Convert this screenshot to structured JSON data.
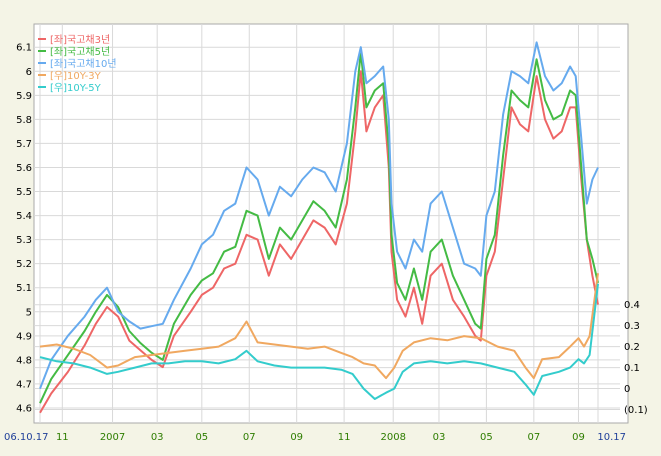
{
  "chart_data": {
    "type": "line",
    "left_axis": {
      "ticks": [
        "4.6",
        "4.7",
        "4.8",
        "4.9",
        "5",
        "5.1",
        "5.2",
        "5.3",
        "5.4",
        "5.5",
        "5.6",
        "5.7",
        "5.8",
        "5.9",
        "6",
        "6.1"
      ],
      "ylim": [
        4.55,
        6.18
      ]
    },
    "right_axis": {
      "ticks": [
        "0.4",
        "0.3",
        "0.2",
        "0.1",
        "0",
        "(0.1)"
      ],
      "ylim": [
        -0.15,
        1.72
      ]
    },
    "x_ticks": [
      {
        "label": "06.10.17",
        "pos": 0.0,
        "color": "#1f3f99"
      },
      {
        "label": "11",
        "pos": 0.04,
        "color": "#2e7d00"
      },
      {
        "label": "2007",
        "pos": 0.13,
        "color": "#2e7d00"
      },
      {
        "label": "03",
        "pos": 0.21,
        "color": "#2e7d00"
      },
      {
        "label": "05",
        "pos": 0.29,
        "color": "#2e7d00"
      },
      {
        "label": "07",
        "pos": 0.375,
        "color": "#2e7d00"
      },
      {
        "label": "09",
        "pos": 0.46,
        "color": "#2e7d00"
      },
      {
        "label": "11",
        "pos": 0.545,
        "color": "#2e7d00"
      },
      {
        "label": "2008",
        "pos": 0.633,
        "color": "#2e7d00"
      },
      {
        "label": "03",
        "pos": 0.715,
        "color": "#2e7d00"
      },
      {
        "label": "05",
        "pos": 0.8,
        "color": "#2e7d00"
      },
      {
        "label": "07",
        "pos": 0.885,
        "color": "#2e7d00"
      },
      {
        "label": "09",
        "pos": 0.965,
        "color": "#2e7d00"
      },
      {
        "label": "10.17",
        "pos": 1.0,
        "color": "#1f3f99"
      }
    ],
    "grid": true,
    "legend_position": "top-left",
    "series": [
      {
        "name": "[좌]국고채3년",
        "axis": "left",
        "color": "#ee6666",
        "points": [
          [
            0,
            4.58
          ],
          [
            0.02,
            4.66
          ],
          [
            0.05,
            4.75
          ],
          [
            0.08,
            4.86
          ],
          [
            0.1,
            4.95
          ],
          [
            0.12,
            5.02
          ],
          [
            0.14,
            4.98
          ],
          [
            0.16,
            4.88
          ],
          [
            0.18,
            4.84
          ],
          [
            0.2,
            4.8
          ],
          [
            0.22,
            4.77
          ],
          [
            0.24,
            4.9
          ],
          [
            0.27,
            5.0
          ],
          [
            0.29,
            5.07
          ],
          [
            0.31,
            5.1
          ],
          [
            0.33,
            5.18
          ],
          [
            0.35,
            5.2
          ],
          [
            0.37,
            5.32
          ],
          [
            0.39,
            5.3
          ],
          [
            0.41,
            5.15
          ],
          [
            0.43,
            5.28
          ],
          [
            0.45,
            5.22
          ],
          [
            0.47,
            5.3
          ],
          [
            0.49,
            5.38
          ],
          [
            0.51,
            5.35
          ],
          [
            0.53,
            5.28
          ],
          [
            0.55,
            5.45
          ],
          [
            0.565,
            5.75
          ],
          [
            0.575,
            6.0
          ],
          [
            0.585,
            5.75
          ],
          [
            0.6,
            5.85
          ],
          [
            0.615,
            5.9
          ],
          [
            0.625,
            5.6
          ],
          [
            0.63,
            5.25
          ],
          [
            0.64,
            5.05
          ],
          [
            0.655,
            4.98
          ],
          [
            0.67,
            5.1
          ],
          [
            0.685,
            4.95
          ],
          [
            0.7,
            5.15
          ],
          [
            0.72,
            5.2
          ],
          [
            0.74,
            5.05
          ],
          [
            0.76,
            4.98
          ],
          [
            0.78,
            4.9
          ],
          [
            0.79,
            4.88
          ],
          [
            0.8,
            5.15
          ],
          [
            0.815,
            5.25
          ],
          [
            0.83,
            5.55
          ],
          [
            0.845,
            5.85
          ],
          [
            0.86,
            5.78
          ],
          [
            0.875,
            5.75
          ],
          [
            0.89,
            5.98
          ],
          [
            0.905,
            5.8
          ],
          [
            0.92,
            5.72
          ],
          [
            0.935,
            5.75
          ],
          [
            0.95,
            5.85
          ],
          [
            0.96,
            5.85
          ],
          [
            0.97,
            5.55
          ],
          [
            0.98,
            5.3
          ],
          [
            0.99,
            5.15
          ],
          [
            1.0,
            5.03
          ]
        ]
      },
      {
        "name": "[좌]국고채5년",
        "axis": "left",
        "color": "#44bb44",
        "points": [
          [
            0,
            4.62
          ],
          [
            0.02,
            4.72
          ],
          [
            0.05,
            4.82
          ],
          [
            0.08,
            4.92
          ],
          [
            0.1,
            5.0
          ],
          [
            0.12,
            5.07
          ],
          [
            0.14,
            5.02
          ],
          [
            0.16,
            4.92
          ],
          [
            0.18,
            4.87
          ],
          [
            0.2,
            4.83
          ],
          [
            0.22,
            4.8
          ],
          [
            0.24,
            4.95
          ],
          [
            0.27,
            5.07
          ],
          [
            0.29,
            5.13
          ],
          [
            0.31,
            5.16
          ],
          [
            0.33,
            5.25
          ],
          [
            0.35,
            5.27
          ],
          [
            0.37,
            5.42
          ],
          [
            0.39,
            5.4
          ],
          [
            0.41,
            5.22
          ],
          [
            0.43,
            5.35
          ],
          [
            0.45,
            5.3
          ],
          [
            0.47,
            5.38
          ],
          [
            0.49,
            5.46
          ],
          [
            0.51,
            5.42
          ],
          [
            0.53,
            5.35
          ],
          [
            0.55,
            5.55
          ],
          [
            0.565,
            5.85
          ],
          [
            0.575,
            6.08
          ],
          [
            0.585,
            5.85
          ],
          [
            0.6,
            5.92
          ],
          [
            0.615,
            5.95
          ],
          [
            0.625,
            5.68
          ],
          [
            0.63,
            5.32
          ],
          [
            0.64,
            5.12
          ],
          [
            0.655,
            5.05
          ],
          [
            0.67,
            5.18
          ],
          [
            0.685,
            5.05
          ],
          [
            0.7,
            5.25
          ],
          [
            0.72,
            5.3
          ],
          [
            0.74,
            5.15
          ],
          [
            0.76,
            5.05
          ],
          [
            0.78,
            4.95
          ],
          [
            0.79,
            4.93
          ],
          [
            0.8,
            5.22
          ],
          [
            0.815,
            5.32
          ],
          [
            0.83,
            5.65
          ],
          [
            0.845,
            5.92
          ],
          [
            0.86,
            5.88
          ],
          [
            0.875,
            5.85
          ],
          [
            0.89,
            6.05
          ],
          [
            0.905,
            5.88
          ],
          [
            0.92,
            5.8
          ],
          [
            0.935,
            5.82
          ],
          [
            0.95,
            5.92
          ],
          [
            0.96,
            5.9
          ],
          [
            0.97,
            5.6
          ],
          [
            0.98,
            5.3
          ],
          [
            0.99,
            5.22
          ],
          [
            1.0,
            5.12
          ]
        ]
      },
      {
        "name": "[좌]국고채10년",
        "axis": "left",
        "color": "#66aaee",
        "points": [
          [
            0,
            4.68
          ],
          [
            0.02,
            4.8
          ],
          [
            0.05,
            4.9
          ],
          [
            0.08,
            4.98
          ],
          [
            0.1,
            5.05
          ],
          [
            0.12,
            5.1
          ],
          [
            0.14,
            5.0
          ],
          [
            0.16,
            4.96
          ],
          [
            0.18,
            4.93
          ],
          [
            0.2,
            4.94
          ],
          [
            0.22,
            4.95
          ],
          [
            0.24,
            5.05
          ],
          [
            0.27,
            5.18
          ],
          [
            0.29,
            5.28
          ],
          [
            0.31,
            5.32
          ],
          [
            0.33,
            5.42
          ],
          [
            0.35,
            5.45
          ],
          [
            0.37,
            5.6
          ],
          [
            0.39,
            5.55
          ],
          [
            0.41,
            5.4
          ],
          [
            0.43,
            5.52
          ],
          [
            0.45,
            5.48
          ],
          [
            0.47,
            5.55
          ],
          [
            0.49,
            5.6
          ],
          [
            0.51,
            5.58
          ],
          [
            0.53,
            5.5
          ],
          [
            0.55,
            5.7
          ],
          [
            0.565,
            6.0
          ],
          [
            0.575,
            6.1
          ],
          [
            0.585,
            5.95
          ],
          [
            0.6,
            5.98
          ],
          [
            0.615,
            6.02
          ],
          [
            0.625,
            5.8
          ],
          [
            0.63,
            5.45
          ],
          [
            0.64,
            5.25
          ],
          [
            0.655,
            5.18
          ],
          [
            0.67,
            5.3
          ],
          [
            0.685,
            5.25
          ],
          [
            0.7,
            5.45
          ],
          [
            0.72,
            5.5
          ],
          [
            0.74,
            5.35
          ],
          [
            0.76,
            5.2
          ],
          [
            0.78,
            5.18
          ],
          [
            0.79,
            5.15
          ],
          [
            0.8,
            5.4
          ],
          [
            0.815,
            5.5
          ],
          [
            0.83,
            5.82
          ],
          [
            0.845,
            6.0
          ],
          [
            0.86,
            5.98
          ],
          [
            0.875,
            5.95
          ],
          [
            0.89,
            6.12
          ],
          [
            0.905,
            5.98
          ],
          [
            0.92,
            5.92
          ],
          [
            0.935,
            5.95
          ],
          [
            0.95,
            6.02
          ],
          [
            0.96,
            5.98
          ],
          [
            0.97,
            5.72
          ],
          [
            0.98,
            5.45
          ],
          [
            0.99,
            5.55
          ],
          [
            1.0,
            5.6
          ]
        ]
      },
      {
        "name": "[우]10Y-3Y",
        "axis": "right",
        "color": "#f0a860",
        "points": [
          [
            0,
            0.2
          ],
          [
            0.03,
            0.21
          ],
          [
            0.06,
            0.19
          ],
          [
            0.09,
            0.16
          ],
          [
            0.12,
            0.1
          ],
          [
            0.14,
            0.11
          ],
          [
            0.17,
            0.15
          ],
          [
            0.2,
            0.16
          ],
          [
            0.23,
            0.17
          ],
          [
            0.26,
            0.18
          ],
          [
            0.29,
            0.19
          ],
          [
            0.32,
            0.2
          ],
          [
            0.35,
            0.24
          ],
          [
            0.37,
            0.32
          ],
          [
            0.39,
            0.22
          ],
          [
            0.42,
            0.21
          ],
          [
            0.45,
            0.2
          ],
          [
            0.48,
            0.19
          ],
          [
            0.51,
            0.2
          ],
          [
            0.54,
            0.17
          ],
          [
            0.56,
            0.15
          ],
          [
            0.58,
            0.12
          ],
          [
            0.6,
            0.11
          ],
          [
            0.62,
            0.05
          ],
          [
            0.635,
            0.1
          ],
          [
            0.65,
            0.18
          ],
          [
            0.67,
            0.22
          ],
          [
            0.7,
            0.24
          ],
          [
            0.73,
            0.23
          ],
          [
            0.76,
            0.25
          ],
          [
            0.79,
            0.24
          ],
          [
            0.82,
            0.2
          ],
          [
            0.85,
            0.18
          ],
          [
            0.87,
            0.1
          ],
          [
            0.885,
            0.05
          ],
          [
            0.9,
            0.14
          ],
          [
            0.93,
            0.15
          ],
          [
            0.95,
            0.2
          ],
          [
            0.965,
            0.24
          ],
          [
            0.975,
            0.2
          ],
          [
            0.985,
            0.25
          ],
          [
            1.0,
            0.55
          ]
        ]
      },
      {
        "name": "[우]10Y-5Y",
        "axis": "right",
        "color": "#33cccc",
        "points": [
          [
            0,
            0.15
          ],
          [
            0.03,
            0.13
          ],
          [
            0.06,
            0.12
          ],
          [
            0.09,
            0.1
          ],
          [
            0.12,
            0.07
          ],
          [
            0.14,
            0.08
          ],
          [
            0.17,
            0.1
          ],
          [
            0.2,
            0.12
          ],
          [
            0.23,
            0.12
          ],
          [
            0.26,
            0.13
          ],
          [
            0.29,
            0.13
          ],
          [
            0.32,
            0.12
          ],
          [
            0.35,
            0.14
          ],
          [
            0.37,
            0.18
          ],
          [
            0.39,
            0.13
          ],
          [
            0.42,
            0.11
          ],
          [
            0.45,
            0.1
          ],
          [
            0.48,
            0.1
          ],
          [
            0.51,
            0.1
          ],
          [
            0.54,
            0.09
          ],
          [
            0.56,
            0.07
          ],
          [
            0.58,
            0.0
          ],
          [
            0.6,
            -0.05
          ],
          [
            0.62,
            -0.02
          ],
          [
            0.635,
            0.0
          ],
          [
            0.65,
            0.08
          ],
          [
            0.67,
            0.12
          ],
          [
            0.7,
            0.13
          ],
          [
            0.73,
            0.12
          ],
          [
            0.76,
            0.13
          ],
          [
            0.79,
            0.12
          ],
          [
            0.82,
            0.1
          ],
          [
            0.85,
            0.08
          ],
          [
            0.87,
            0.02
          ],
          [
            0.885,
            -0.03
          ],
          [
            0.9,
            0.06
          ],
          [
            0.93,
            0.08
          ],
          [
            0.95,
            0.1
          ],
          [
            0.965,
            0.14
          ],
          [
            0.975,
            0.12
          ],
          [
            0.985,
            0.16
          ],
          [
            1.0,
            0.5
          ]
        ]
      }
    ]
  }
}
